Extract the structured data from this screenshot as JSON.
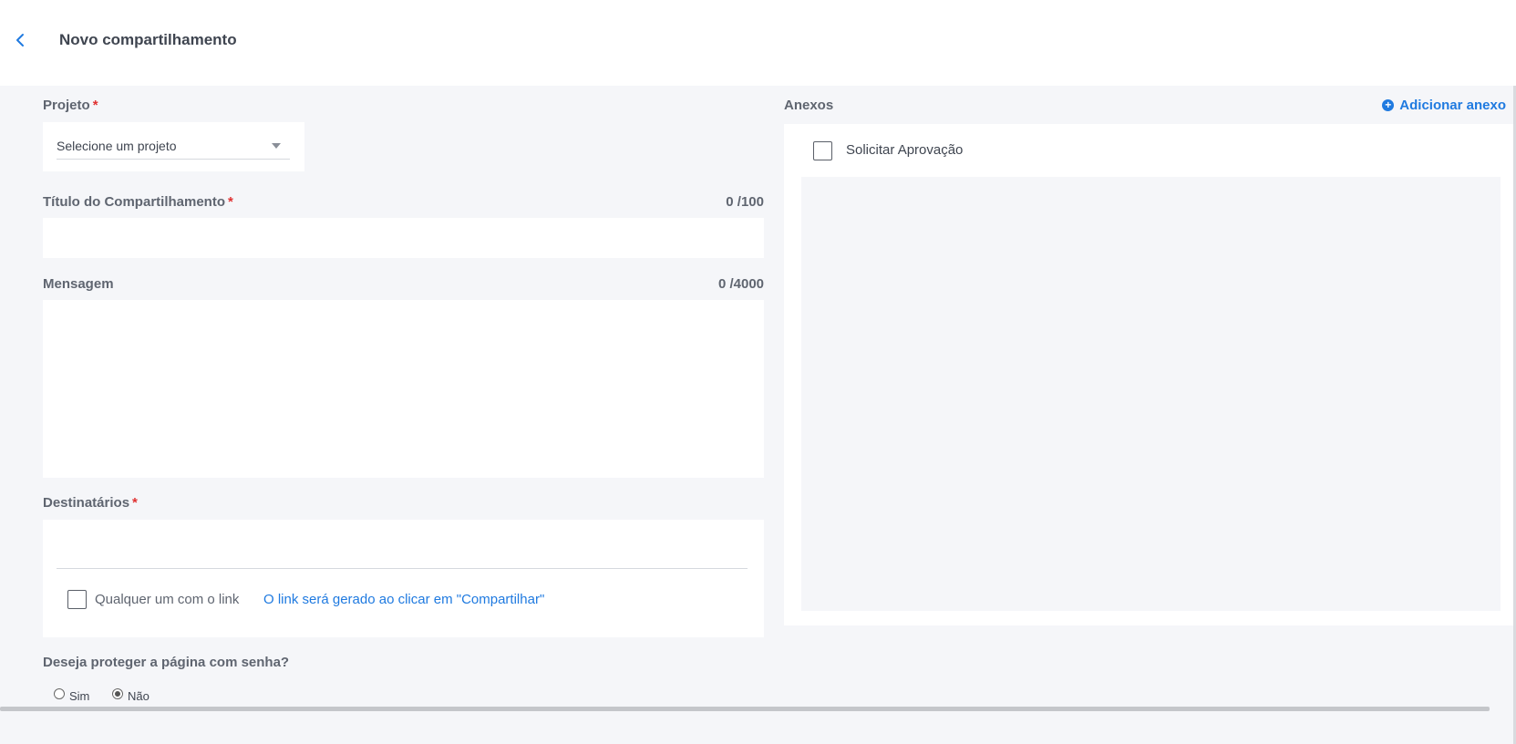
{
  "header": {
    "title": "Novo compartilhamento"
  },
  "project": {
    "label": "Projeto",
    "required_mark": "*",
    "select_placeholder": "Selecione um projeto"
  },
  "title_field": {
    "label": "Título do Compartilhamento",
    "required_mark": "*",
    "counter": "0 /100",
    "value": ""
  },
  "message_field": {
    "label": "Mensagem",
    "counter": "0 /4000",
    "value": ""
  },
  "recipients": {
    "label": "Destinatários",
    "required_mark": "*",
    "anyone_with_link_label": "Qualquer um com o link",
    "anyone_with_link_checked": false,
    "link_note": "O link será gerado ao clicar em \"Compartilhar\""
  },
  "password_protection": {
    "question": "Deseja proteger a página com senha?",
    "options": [
      {
        "label": "Sim",
        "checked": false
      },
      {
        "label": "Não",
        "checked": true
      }
    ]
  },
  "attachments": {
    "label": "Anexos",
    "add_label": "Adicionar anexo",
    "request_approval_label": "Solicitar Aprovação",
    "request_approval_checked": false
  },
  "colors": {
    "accent": "#1f7ae0",
    "required": "#e03131",
    "background": "#f5f6f9"
  }
}
